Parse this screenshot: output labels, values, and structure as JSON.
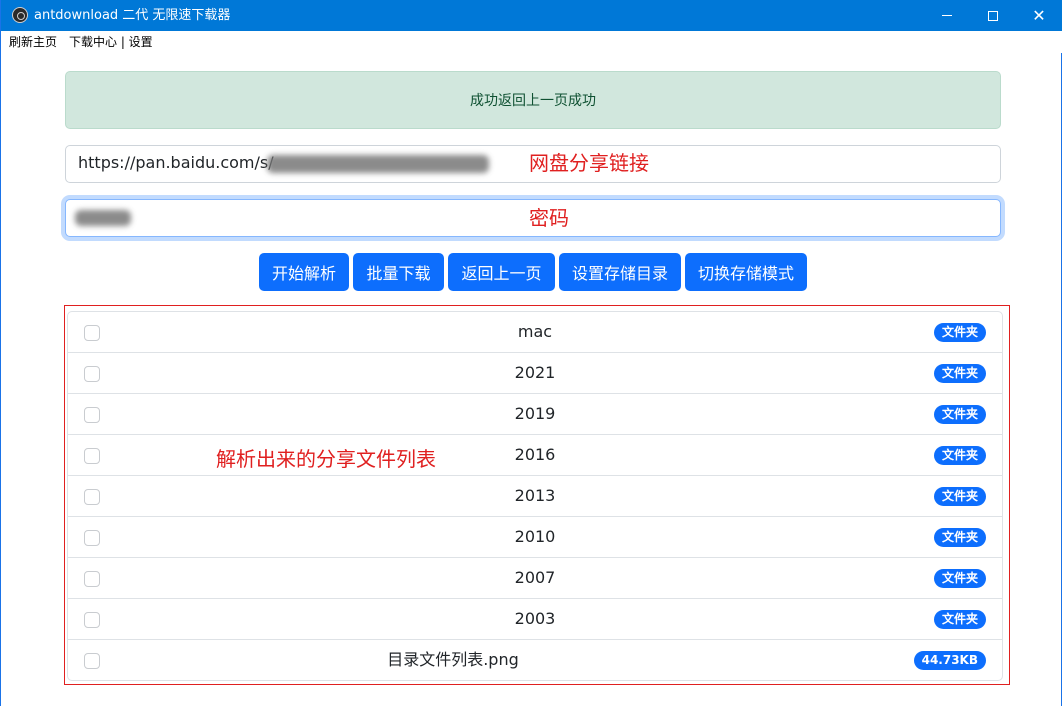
{
  "window": {
    "title": "antdownload 二代 无限速下载器",
    "close_glyph": "✕"
  },
  "menu": {
    "items": [
      "刷新主页",
      "下载中心 | 设置"
    ]
  },
  "alert": {
    "message": "成功返回上一页成功"
  },
  "share_url": {
    "value_visible": "https://pan.baidu.com/s/",
    "annotation": "网盘分享链接"
  },
  "password": {
    "annotation": "密码"
  },
  "buttons": [
    "开始解析",
    "批量下载",
    "返回上一页",
    "设置存储目录",
    "切换存储模式"
  ],
  "file_list": {
    "annotation": "解析出来的分享文件列表",
    "rows": [
      {
        "name": "mac",
        "badge": "文件夹"
      },
      {
        "name": "2021",
        "badge": "文件夹"
      },
      {
        "name": "2019",
        "badge": "文件夹"
      },
      {
        "name": "2016",
        "badge": "文件夹"
      },
      {
        "name": "2013",
        "badge": "文件夹"
      },
      {
        "name": "2010",
        "badge": "文件夹"
      },
      {
        "name": "2007",
        "badge": "文件夹"
      },
      {
        "name": "2003",
        "badge": "文件夹"
      },
      {
        "name": "目录文件列表.png",
        "badge": "44.73KB"
      }
    ]
  },
  "colors": {
    "titlebar": "#0078d7",
    "primary": "#0d6efd",
    "alert_bg": "#d1e7dd",
    "annotation": "#e02020"
  },
  "icons": [
    "app-icon",
    "minimize-icon",
    "maximize-icon",
    "close-icon",
    "checkbox-icon"
  ]
}
